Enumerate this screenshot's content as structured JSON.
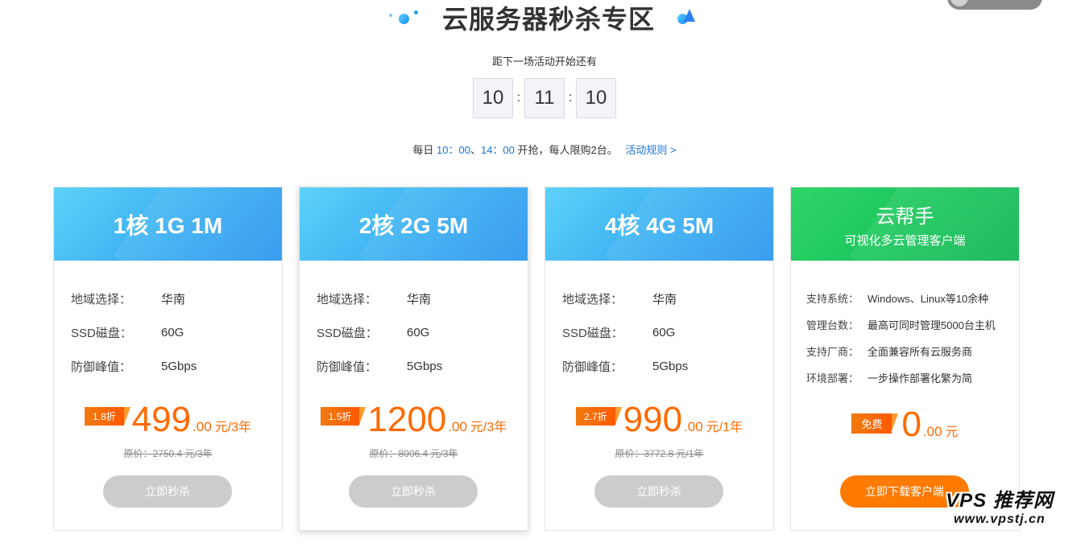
{
  "header": {
    "title": "云服务器秒杀专区",
    "countdown_label": "距下一场活动开始还有",
    "countdown": {
      "hours": "10",
      "minutes": "11",
      "seconds": "10",
      "separator": ":"
    },
    "schedule": {
      "prefix": "每日",
      "time1": "10：00",
      "join": "、",
      "time2": "14：00",
      "suffix": "开抢，每人限购2台。",
      "rules_link": "活动规则 >"
    }
  },
  "cards": [
    {
      "title": "1核 1G 1M",
      "specs": [
        {
          "label": "地域选择：",
          "value": "华南"
        },
        {
          "label": "SSD磁盘：",
          "value": "60G"
        },
        {
          "label": "防御峰值：",
          "value": "5Gbps"
        }
      ],
      "discount": "1.8折",
      "price_int": "499",
      "price_dec": ".00",
      "unit": "元/3年",
      "original": "原价：2750.4 元/3年",
      "button": "立即秒杀"
    },
    {
      "title": "2核 2G 5M",
      "specs": [
        {
          "label": "地域选择：",
          "value": "华南"
        },
        {
          "label": "SSD磁盘：",
          "value": "60G"
        },
        {
          "label": "防御峰值：",
          "value": "5Gbps"
        }
      ],
      "discount": "1.5折",
      "price_int": "1200",
      "price_dec": ".00",
      "unit": "元/3年",
      "original": "原价：8006.4 元/3年",
      "button": "立即秒杀"
    },
    {
      "title": "4核 4G 5M",
      "specs": [
        {
          "label": "地域选择：",
          "value": "华南"
        },
        {
          "label": "SSD磁盘：",
          "value": "60G"
        },
        {
          "label": "防御峰值：",
          "value": "5Gbps"
        }
      ],
      "discount": "2.7折",
      "price_int": "990",
      "price_dec": ".00",
      "unit": "元/1年",
      "original": "原价：3772.8 元/1年",
      "button": "立即秒杀"
    }
  ],
  "helper_card": {
    "title": "云帮手",
    "subtitle": "可视化多云管理客户端",
    "specs": [
      {
        "label": "支持系统：",
        "value": "Windows、Linux等10余种"
      },
      {
        "label": "管理台数：",
        "value": "最高可同时管理5000台主机"
      },
      {
        "label": "支持厂商：",
        "value": "全面兼容所有云服务商"
      },
      {
        "label": "环境部署：",
        "value": "一步操作部署化繁为简"
      }
    ],
    "badge": "免费",
    "price_int": "0",
    "price_dec": ".00",
    "unit": "元",
    "button": "立即下载客户端"
  },
  "watermark": {
    "top": "VPS 推荐网",
    "bottom": "www.vpstj.cn"
  },
  "colors": {
    "accent_orange": "#ff6a00",
    "blue_link": "#1a73d9",
    "card_blue": "#3aaef2",
    "card_green": "#18c35a"
  }
}
